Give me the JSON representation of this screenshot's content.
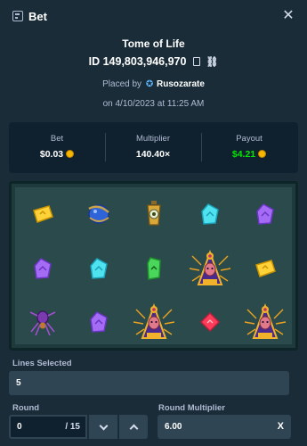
{
  "header": {
    "title": "Bet",
    "close_icon": "close-icon",
    "bet_icon": "bet-slip-icon"
  },
  "game": {
    "name": "Tome of Life",
    "id_label": "ID 149,803,946,970",
    "placed_by_prefix": "Placed by",
    "username": "Rusozarate",
    "date": "on 4/10/2023 at 11:25 AM"
  },
  "stats": {
    "bet_label": "Bet",
    "bet_value": "$0.03",
    "multiplier_label": "Multiplier",
    "multiplier_value": "140.40×",
    "payout_label": "Payout",
    "payout_value": "$4.21",
    "payout_color": "#00e701"
  },
  "reels": {
    "symbols": [
      [
        "yellow-gem",
        "blue-orb",
        "lantern",
        "cyan-gem",
        "purple-gem"
      ],
      [
        "purple-gem",
        "cyan-gem",
        "green-gem",
        "pharaoh",
        "yellow-gem"
      ],
      [
        "spider",
        "purple-gem",
        "pharaoh",
        "red-gem",
        "pharaoh"
      ]
    ]
  },
  "controls": {
    "lines_label": "Lines Selected",
    "lines_value": "5",
    "round_label": "Round",
    "round_value": "0",
    "round_total": "/ 15",
    "round_multiplier_label": "Round Multiplier",
    "round_multiplier_value": "6.00",
    "round_multiplier_suffix": "X"
  }
}
